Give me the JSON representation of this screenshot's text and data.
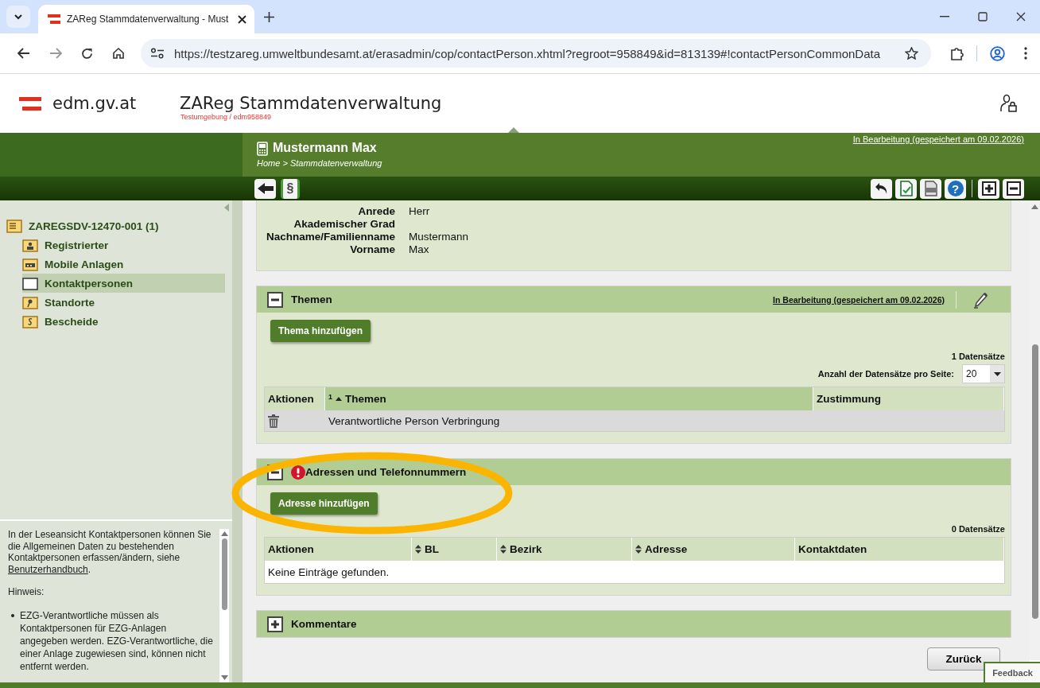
{
  "browser": {
    "tab_title": "ZAReg Stammdatenverwaltung - Must",
    "url": "https://testzareg.umweltbundesamt.at/erasadmin/cop/contactPerson.xhtml?regroot=958849&id=813139#!contactPersonCommonData"
  },
  "header": {
    "logo_text": "edm.gv.at",
    "app_title": "ZAReg Stammdatenverwaltung",
    "environment": "Testumgebung / edm958849"
  },
  "page_header": {
    "title": "Mustermann Max",
    "breadcrumb": "Home > Stammdatenverwaltung",
    "status_link": "In Bearbeitung (gespeichert am 09.02.2026)"
  },
  "toolbar": {
    "left": [
      {
        "kind": "back"
      },
      {
        "kind": "paragraph",
        "glyph": "§"
      }
    ],
    "right": [
      {
        "kind": "undo"
      },
      {
        "kind": "validate"
      },
      {
        "kind": "pdf"
      },
      {
        "kind": "help",
        "glyph": "?"
      },
      {
        "kind": "expand_all"
      },
      {
        "kind": "collapse_all"
      }
    ]
  },
  "sidebar": {
    "root": {
      "label": "ZAREGSDV-12470-001 (1)",
      "children": [
        {
          "label": "Registrierter",
          "kind": "person",
          "selected": false
        },
        {
          "label": "Mobile Anlagen",
          "kind": "machine",
          "selected": false
        },
        {
          "label": "Kontaktpersonen",
          "kind": "blank",
          "selected": true
        },
        {
          "label": "Standorte",
          "kind": "pin",
          "selected": false
        },
        {
          "label": "Bescheide",
          "kind": "decree",
          "selected": false
        }
      ]
    },
    "help": {
      "text_before": "In der Leseansicht Kontaktpersonen können Sie die Allgemeinen Daten zu bestehenden Kontaktpersonen erfassen/ändern, siehe ",
      "link": "Benutzerhandbuch",
      "text_after": ".",
      "hint_label": "Hinweis:",
      "bullets": [
        "EZG-Verantwortliche müssen als Kontaktpersonen für EZG-Anlagen angegeben werden. EZG-Verantwortliche, die einer Anlage zugewiesen sind, können nicht entfernt werden."
      ]
    }
  },
  "details": [
    {
      "label": "Anrede",
      "value": "Herr"
    },
    {
      "label": "Akademischer Grad"
    },
    {
      "label": "Nachname/Familienname",
      "value": "Mustermann"
    },
    {
      "label": "Vorname",
      "value": "Max"
    }
  ],
  "sections": [
    {
      "title": "Themen",
      "expanded": true,
      "warning": false,
      "status_link": "In Bearbeitung (gespeichert am 09.02.2026)",
      "add_button": "Thema hinzufügen",
      "record_count": "1 Datensätze",
      "page_size_label": "Anzahl der Datensätze pro Seite:",
      "page_size": "20",
      "columns": [
        {
          "label": "Aktionen",
          "sortable": false,
          "sorted": false
        },
        {
          "label": "Themen",
          "sortable": true,
          "sorted": true,
          "sort_rank": "1"
        },
        {
          "label": "Zustimmung",
          "sortable": false,
          "sorted": false
        }
      ],
      "rows": [
        {
          "cells": [
            "",
            "Verantwortliche Person Verbringung"
          ]
        }
      ]
    },
    {
      "title": "Adressen und Telefonnummern",
      "expanded": true,
      "warning": true,
      "add_button": "Adresse hinzufügen",
      "record_count": "0 Datensätze",
      "columns": [
        {
          "label": "Aktionen",
          "sortable": false,
          "sorted": false
        },
        {
          "label": "BL",
          "sortable": true,
          "sorted": false
        },
        {
          "label": "Bezirk",
          "sortable": true,
          "sorted": false
        },
        {
          "label": "Adresse",
          "sortable": true,
          "sorted": false
        },
        {
          "label": "Kontaktdaten",
          "sortable": false,
          "sorted": false
        }
      ],
      "empty_text": "Keine Einträge gefunden."
    },
    {
      "title": "Kommentare",
      "expanded": false,
      "warning": false
    }
  ],
  "buttons": {
    "back": "Zurück",
    "feedback": "Feedback"
  }
}
